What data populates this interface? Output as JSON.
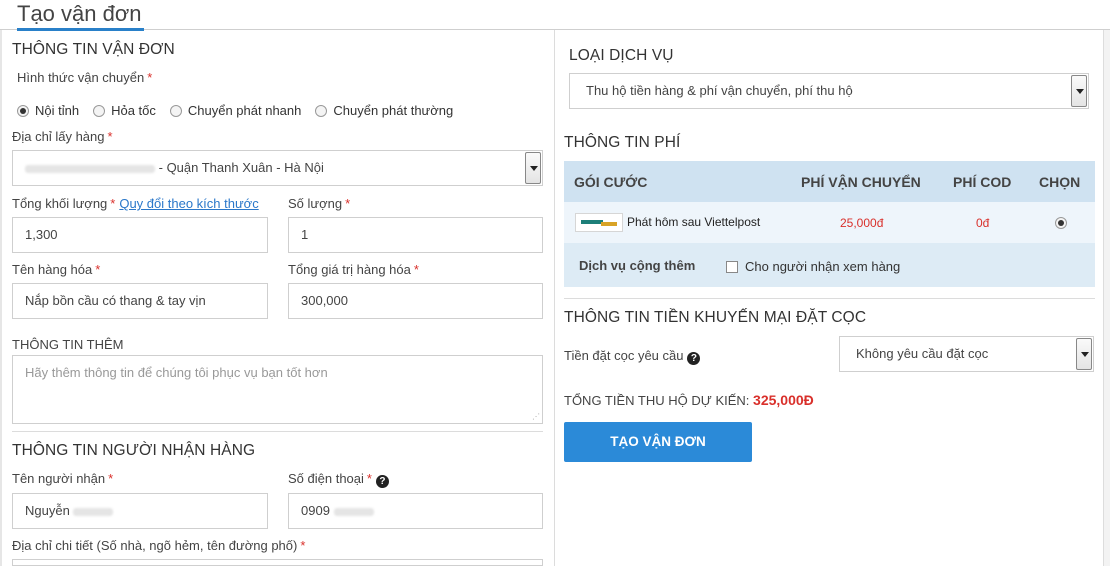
{
  "page_title": "Tạo vận đơn",
  "left": {
    "shipment_section_title": "THÔNG TIN VẬN ĐƠN",
    "shipping_method_label": "Hình thức vận chuyển",
    "shipping_methods": [
      "Nội tỉnh",
      "Hỏa tốc",
      "Chuyển phát nhanh",
      "Chuyển phát thường"
    ],
    "selected_method": "Nội tỉnh",
    "pickup_address_label": "Địa chỉ lấy hàng",
    "pickup_address_value": "- Quận Thanh Xuân - Hà Nội",
    "total_weight_label": "Tổng khối lượng",
    "convert_link": "Quy đổi theo kích thước",
    "total_weight_value": "1,300",
    "quantity_label": "Số lượng",
    "quantity_value": "1",
    "product_name_label": "Tên hàng hóa",
    "product_name_value": "Nắp bồn cầu có thang & tay vịn",
    "total_value_label": "Tổng giá trị hàng hóa",
    "total_value_value": "300,000",
    "extra_info_title": "THÔNG TIN THÊM",
    "extra_info_placeholder": "Hãy thêm thông tin để chúng tôi phục vụ bạn tốt hơn",
    "receiver_section_title": "THÔNG TIN NGƯỜI NHẬN HÀNG",
    "receiver_name_label": "Tên người nhận",
    "receiver_name_value": "Nguyễn",
    "phone_label": "Số điện thoại",
    "phone_value": "0909",
    "address_detail_label": "Địa chỉ chi tiết (Số nhà, ngõ hẻm, tên đường phố)",
    "required_mark": "*"
  },
  "right": {
    "service_type_title": "LOẠI DỊCH VỤ",
    "service_type_value": "Thu hộ tiền hàng & phí vận chuyển, phí thu hộ",
    "fee_section_title": "THÔNG TIN PHÍ",
    "fee_table": {
      "headers": [
        "GÓI CƯỚC",
        "PHÍ VẬN CHUYỂN",
        "PHÍ COD",
        "CHỌN"
      ],
      "rows": [
        {
          "package": "Phát hôm sau Viettelpost",
          "shipping_fee": "25,000đ",
          "cod_fee": "0đ",
          "selected": true
        }
      ],
      "addon_label": "Dịch vụ cộng thêm",
      "addon_option": "Cho người nhận xem hàng"
    },
    "deposit_section_title": "THÔNG TIN TIỀN KHUYẾN MẠI ĐẶT CỌC",
    "deposit_label": "Tiền đặt cọc yêu cầu",
    "deposit_value": "Không yêu cầu đặt cọc",
    "total_cod_label": "TỔNG TIỀN THU HỘ DỰ KIẾN:",
    "total_cod_value": "325,000Đ",
    "create_button": "TẠO VẬN ĐƠN"
  },
  "colors": {
    "accent": "#2b8ad8",
    "required": "#d9302b",
    "table_header": "#cfe2f1",
    "table_body": "#ddebf5"
  }
}
